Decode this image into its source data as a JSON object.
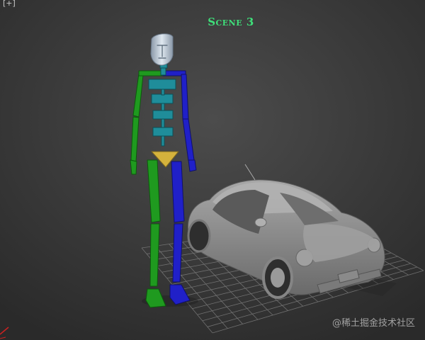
{
  "viewport": {
    "corner_label": "[+]",
    "scene_title": "Scene 3",
    "watermark": "@稀土掘金技术社区"
  },
  "colors": {
    "background_top": "#4a4a4a",
    "background_bottom": "#2c2c2c",
    "grid": "#8a8a8a",
    "title": "#3fe07a",
    "biped_left_side": "#1f9a1f",
    "biped_right_side": "#2020c8",
    "spine": "#1f8d9a",
    "pelvis": "#d4b23c",
    "head": "#c7d4e0",
    "car_body": "#8c8c8c",
    "viewcube_marker": "#cc2222"
  },
  "objects": [
    {
      "name": "biped-character",
      "icon": "biped-figure"
    },
    {
      "name": "car-model",
      "icon": "beetle-car"
    },
    {
      "name": "ground-grid",
      "icon": "grid-plane"
    }
  ]
}
